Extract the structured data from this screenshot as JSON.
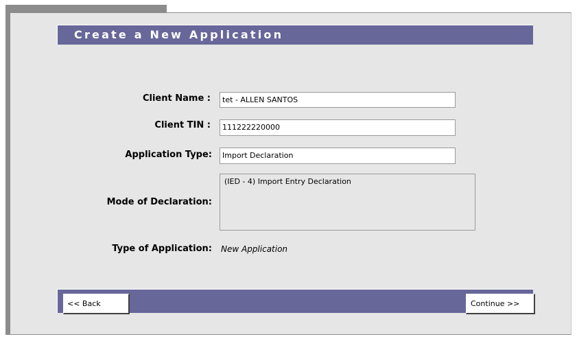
{
  "form": {
    "title": "Create a New Application",
    "client_name_label": "Client Name :",
    "client_name_value": "tet - ALLEN SANTOS",
    "client_tin_label": "Client TIN :",
    "client_tin_value": "111222220000",
    "application_type_label": "Application Type:",
    "application_type_value": "Import Declaration",
    "mode_label": "Mode of Declaration:",
    "mode_value": "(IED - 4) Import Entry Declaration",
    "type_of_application_label": "Type of Application:",
    "type_of_application_value": "New Application"
  },
  "footer": {
    "back_label": "<< Back",
    "continue_label": "Continue >>"
  },
  "colors": {
    "header_bar": "#67679a",
    "panel_bg": "#e6e6e6"
  }
}
